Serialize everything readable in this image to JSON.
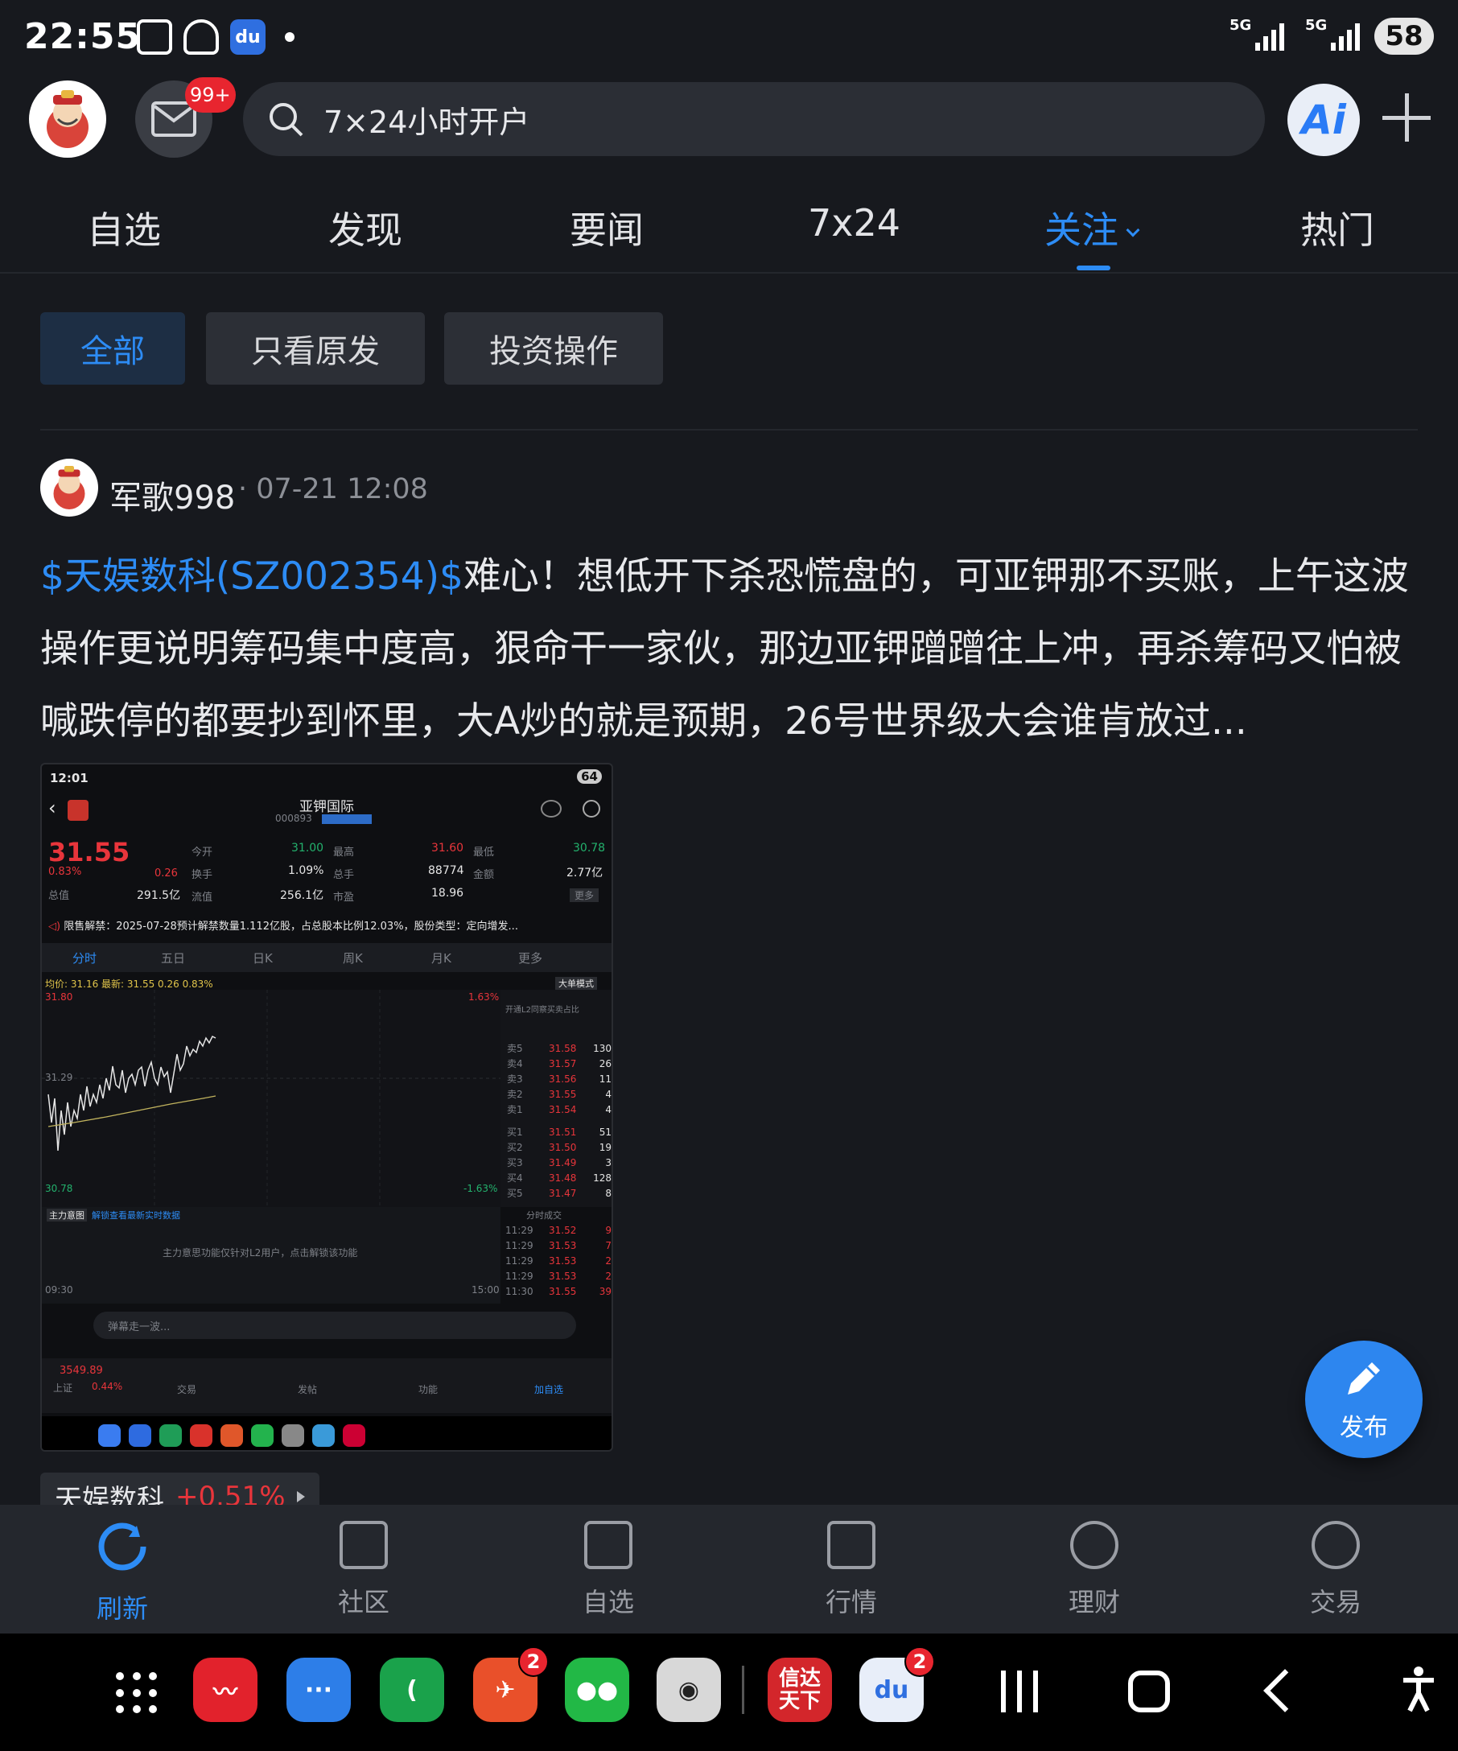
{
  "status_bar": {
    "time": "22:55",
    "signal1_label": "5G",
    "signal2_label": "5G",
    "battery": "58"
  },
  "header": {
    "mail_badge": "99+",
    "search_placeholder": "7×24小时开户",
    "ai_label": "Ai"
  },
  "tabs": [
    {
      "label": "自选"
    },
    {
      "label": "发现"
    },
    {
      "label": "要闻"
    },
    {
      "label": "7x24"
    },
    {
      "label": "关注"
    },
    {
      "label": "热门"
    }
  ],
  "filters": [
    {
      "label": "全部"
    },
    {
      "label": "只看原发"
    },
    {
      "label": "投资操作"
    }
  ],
  "post": {
    "username": "军歌998",
    "time": "· 07-21 12:08",
    "stock_link": "$天娱数科(SZ002354)$",
    "text": "难心！想低开下杀恐慌盘的，可亚钾那不买账，上午这波操作更说明筹码集中度高，狠命干一家伙，那边亚钾蹭蹭往上冲，再杀筹码又怕被喊跌停的都要抄到怀里，大A炒的就是预期，26号世界级大会谁肯放过..."
  },
  "embedded": {
    "time": "12:01",
    "battery": "64",
    "stock_name": "亚钾国际",
    "stock_code": "000893",
    "price": "31.55",
    "change_pct": "0.83%",
    "change": "0.26",
    "k_open_label": "今开",
    "k_open": "31.00",
    "k_high_label": "最高",
    "k_high": "31.60",
    "k_low_label": "最低",
    "k_low": "30.78",
    "k_turnover_label": "换手",
    "k_turnover": "1.09%",
    "k_volume_label": "总手",
    "k_volume": "88774",
    "k_amount_label": "金额",
    "k_amount": "2.77亿",
    "k_mcap_label": "总值",
    "k_mcap": "291.5亿",
    "k_float_label": "流值",
    "k_float": "256.1亿",
    "k_pe_label": "市盈",
    "k_pe": "18.96",
    "more_label": "更多",
    "notice": "限售解禁：2025-07-28预计解禁数量1.112亿股，占总股本比例12.03%，股份类型：定向增发...",
    "chart_tabs": [
      "分时",
      "五日",
      "日K",
      "周K",
      "月K",
      "更多"
    ],
    "avg_line": "均价: 31.16 最新: 31.55 0.26 0.83%",
    "big_order_mode": "大单模式",
    "y_top": "31.80",
    "y_mid": "31.29",
    "y_bot": "30.78",
    "pct_top": "1.63%",
    "pct_bot": "-1.63%",
    "open_l2": "开通L2同察买卖占比",
    "asks": [
      {
        "label": "卖5",
        "price": "31.58",
        "vol": "130"
      },
      {
        "label": "卖4",
        "price": "31.57",
        "vol": "26"
      },
      {
        "label": "卖3",
        "price": "31.56",
        "vol": "11"
      },
      {
        "label": "卖2",
        "price": "31.55",
        "vol": "4"
      },
      {
        "label": "卖1",
        "price": "31.54",
        "vol": "4"
      }
    ],
    "bids": [
      {
        "label": "买1",
        "price": "31.51",
        "vol": "51"
      },
      {
        "label": "买2",
        "price": "31.50",
        "vol": "19"
      },
      {
        "label": "买3",
        "price": "31.49",
        "vol": "3"
      },
      {
        "label": "买4",
        "price": "31.48",
        "vol": "128"
      },
      {
        "label": "买5",
        "price": "31.47",
        "vol": "8"
      }
    ],
    "trades_header": "分时成交",
    "trades": [
      {
        "t": "11:29",
        "p": "31.52",
        "v": "9"
      },
      {
        "t": "11:29",
        "p": "31.53",
        "v": "7"
      },
      {
        "t": "11:29",
        "p": "31.53",
        "v": "2"
      },
      {
        "t": "11:29",
        "p": "31.53",
        "v": "2"
      },
      {
        "t": "11:30",
        "p": "31.55",
        "v": "39"
      }
    ],
    "main_intent": "主力意图",
    "unlock_text": "解锁查看最新实时数据",
    "l2_only": "主力意思功能仅针对L2用户，点击解锁该功能",
    "t_start": "09:30",
    "t_end": "15:00",
    "barrage_placeholder": "弹幕走一波...",
    "index_value": "3549.89",
    "index_name": "上证",
    "index_pct": "0.44%",
    "bottom_items": [
      "交易",
      "发帖",
      "功能",
      "加自选"
    ]
  },
  "stock_tag": {
    "name": "天娱数科",
    "pct": "+0.51%"
  },
  "fab": {
    "label": "发布"
  },
  "bottom_nav": [
    {
      "label": "刷新"
    },
    {
      "label": "社区"
    },
    {
      "label": "自选"
    },
    {
      "label": "行情"
    },
    {
      "label": "理财"
    },
    {
      "label": "交易"
    }
  ],
  "dock": {
    "badge1": "2",
    "badge2": "2",
    "xinda_label": "信达天下"
  },
  "colors": {
    "accent": "#2d8cf5",
    "up_red": "#e8353b",
    "background": "#17191e"
  }
}
